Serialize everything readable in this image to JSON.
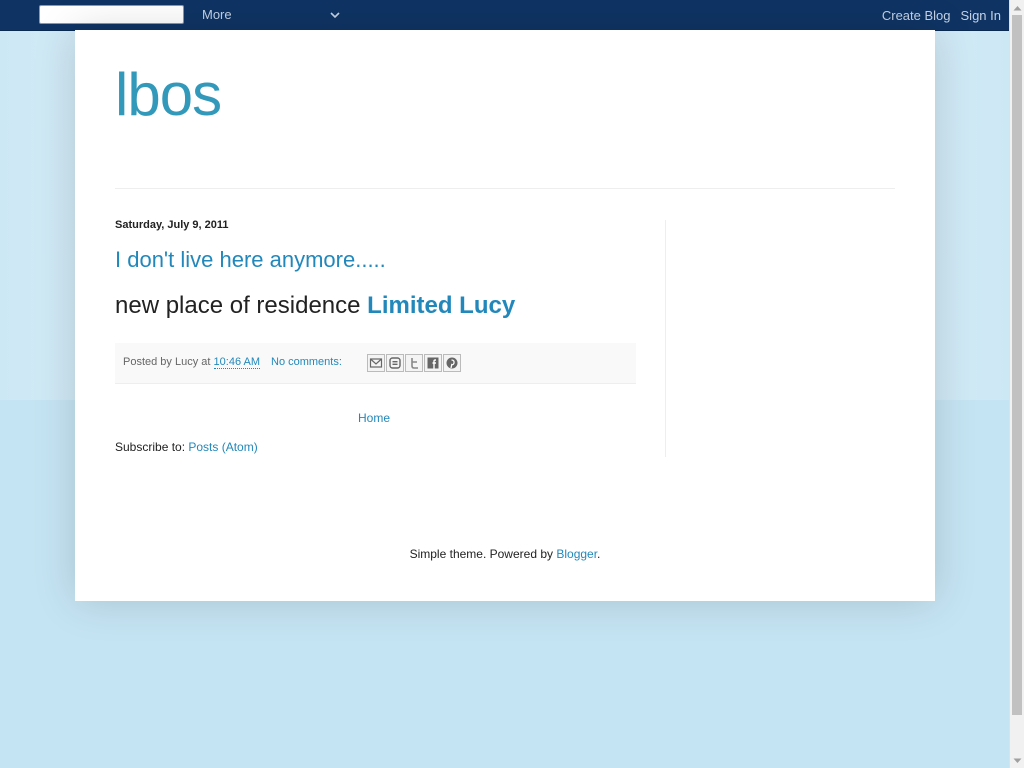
{
  "navbar": {
    "search_value": "",
    "more_label": "More",
    "create_blog": "Create Blog",
    "sign_in": "Sign In"
  },
  "blog": {
    "title": "lbos"
  },
  "post": {
    "date": "Saturday, July 9, 2011",
    "title": "I don't live here anymore.....",
    "body_text": "new place of residence ",
    "body_link": "Limited Lucy",
    "posted_by_prefix": "Posted by ",
    "author": "Lucy",
    "at": " at ",
    "time": "10:46 AM",
    "comments": "No comments:"
  },
  "share": {
    "icons": [
      "email-icon",
      "blogthis-icon",
      "twitter-icon",
      "facebook-icon",
      "pinterest-icon"
    ]
  },
  "nav": {
    "home": "Home"
  },
  "subscribe": {
    "label": "Subscribe to: ",
    "link": "Posts (Atom)"
  },
  "footer": {
    "text": "Simple theme. Powered by ",
    "link": "Blogger",
    "end": "."
  },
  "colors": {
    "navbar": "#0f3464",
    "title": "#3399bb",
    "link": "#2288bb",
    "background": "#c5e4f3"
  }
}
